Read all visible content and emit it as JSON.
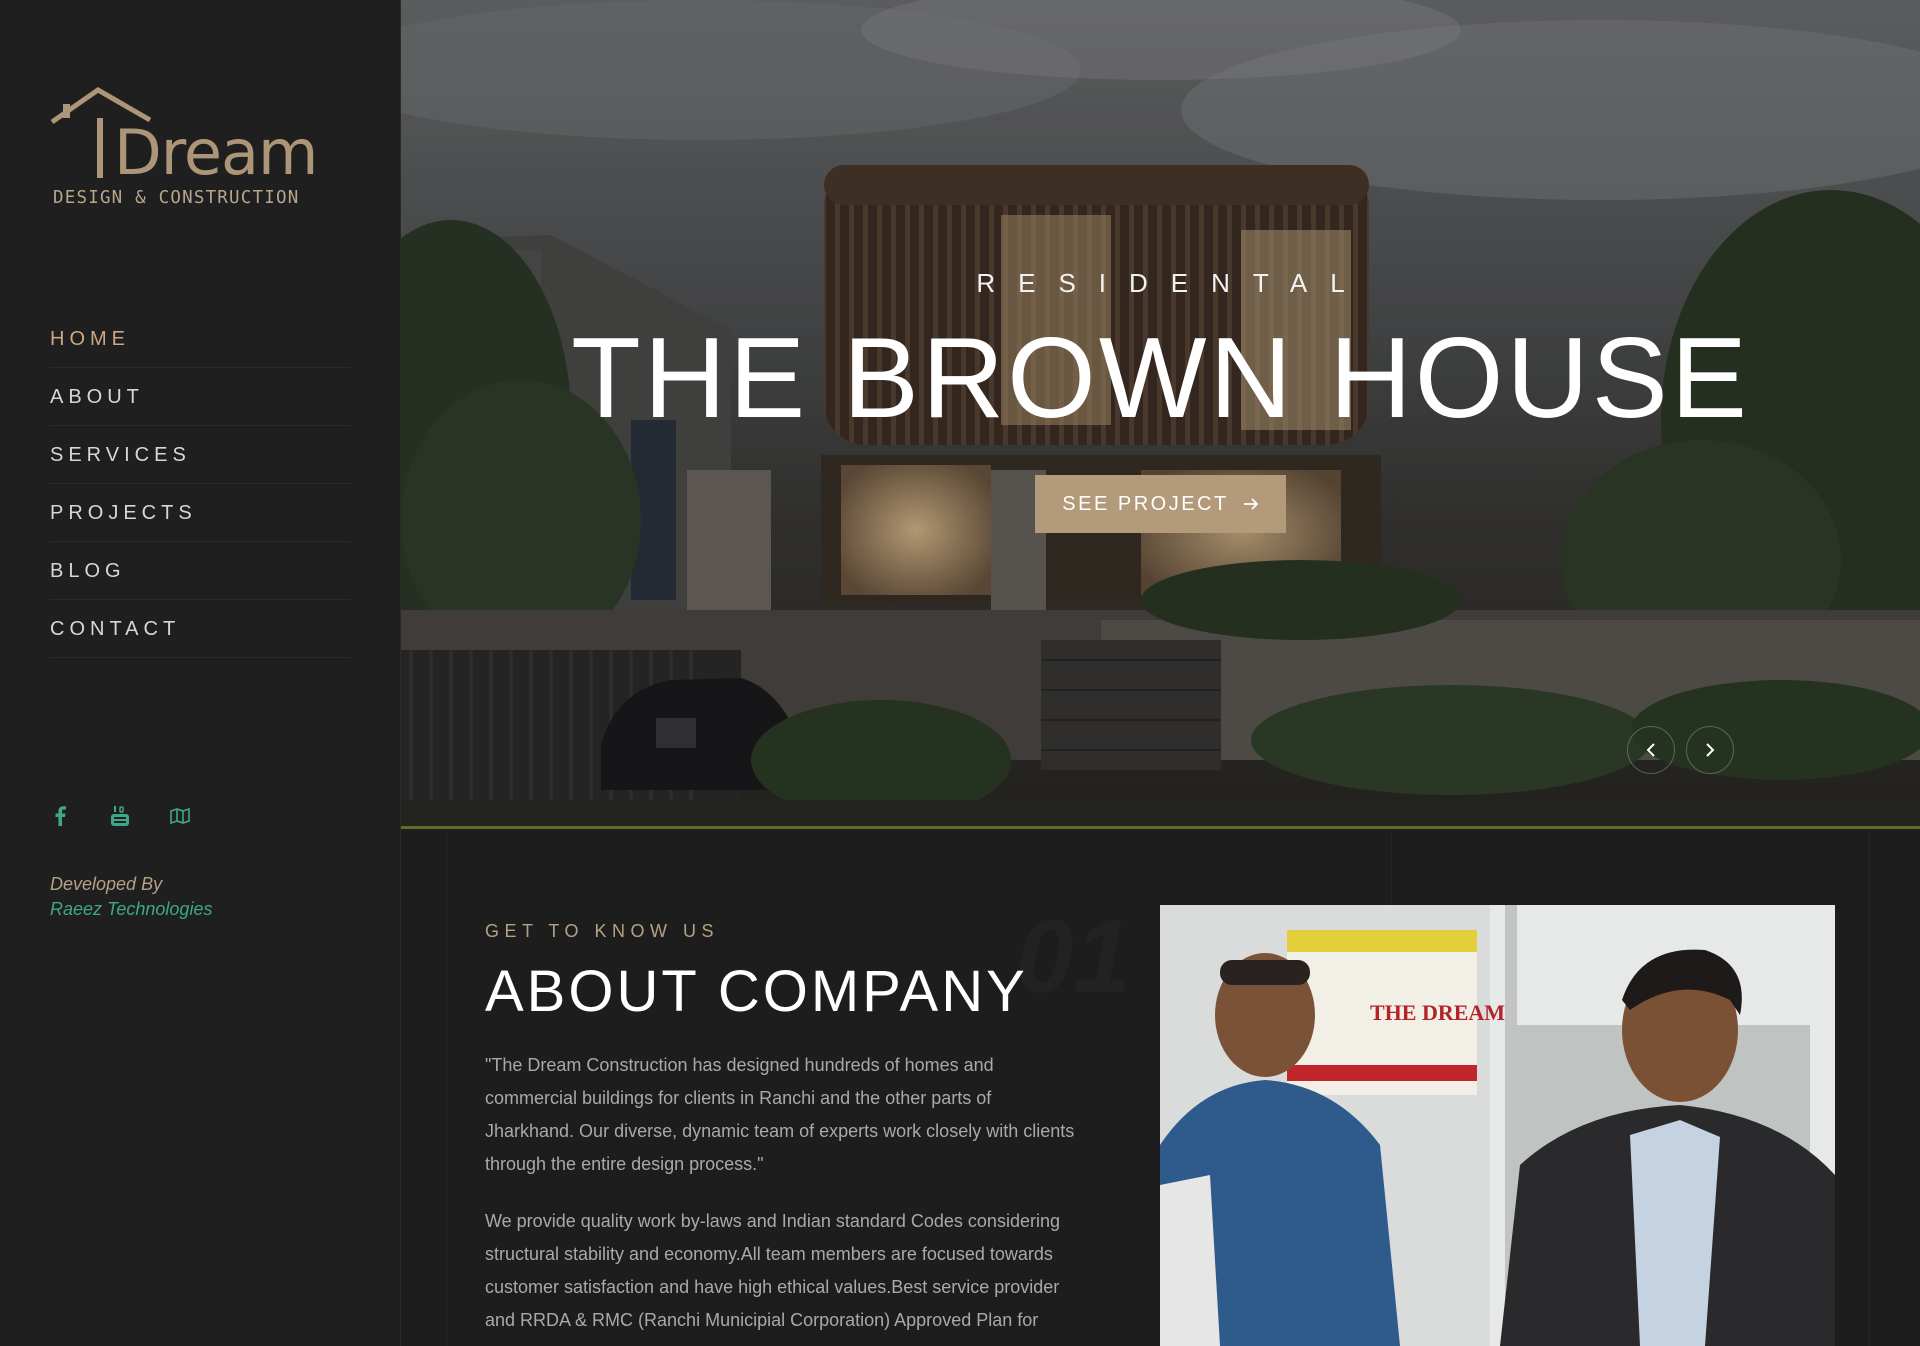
{
  "brand": {
    "name": "Dream",
    "tagline": "DESIGN & CONSTRUCTION",
    "accent_color": "#b29a7b"
  },
  "nav": {
    "items": [
      {
        "label": "HOME"
      },
      {
        "label": "ABOUT"
      },
      {
        "label": "SERVICES"
      },
      {
        "label": "PROJECTS"
      },
      {
        "label": "BLOG"
      },
      {
        "label": "CONTACT"
      }
    ],
    "active": "HOME"
  },
  "social": {
    "icons": [
      "facebook-icon",
      "youtube-icon",
      "map-icon"
    ]
  },
  "credit": {
    "line1": "Developed By",
    "line2": "Raeez Technologies"
  },
  "hero": {
    "category": "RESIDENTAL",
    "title": "THE BROWN HOUSE",
    "button_label": "SEE PROJECT",
    "button_icon": "arrow-right-icon",
    "prev_icon": "chevron-left-icon",
    "next_icon": "chevron-right-icon"
  },
  "about": {
    "kicker": "GET TO KNOW US",
    "number": "01",
    "title": "ABOUT COMPANY",
    "paragraph1": "\"The  Dream Construction has designed hundreds of homes and commercial buildings for clients in  Ranchi and the other parts of Jharkhand. Our diverse, dynamic team of experts work closely with clients through the entire design process.\"",
    "paragraph2": "We provide quality work by-laws and  Indian standard Codes considering structural stability and economy.All team members are focused towards customer satisfaction and have high ethical values.Best service provider and  RRDA & RMC (Ranchi  Municipial Corporation) Approved  Plan for",
    "poster_text": "THE DREAM"
  }
}
